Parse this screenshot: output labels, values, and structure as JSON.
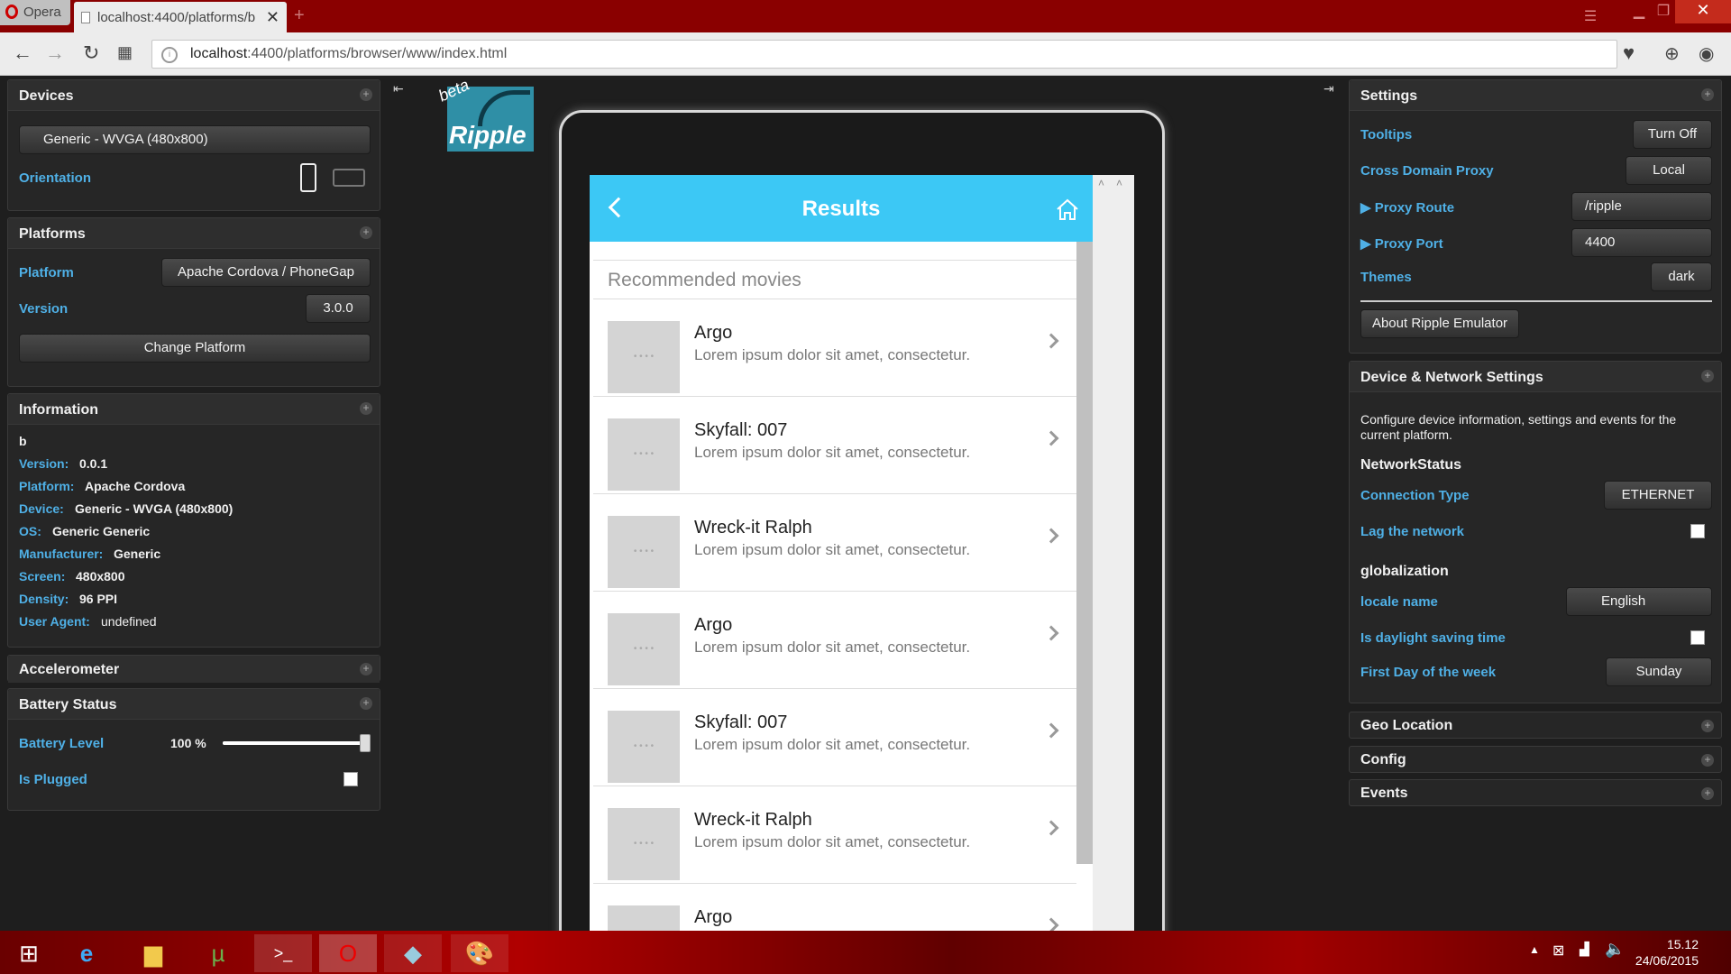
{
  "browser": {
    "app_name": "Opera",
    "tab_title": "localhost:4400/platforms/b",
    "url_host": "localhost",
    "url_path": ":4400/platforms/browser/www/index.html"
  },
  "devices": {
    "title": "Devices",
    "device_button": "Generic - WVGA (480x800)",
    "orientation_label": "Orientation"
  },
  "platforms": {
    "title": "Platforms",
    "platform_label": "Platform",
    "platform_value": "Apache Cordova / PhoneGap",
    "version_label": "Version",
    "version_value": "3.0.0",
    "change_button": "Change Platform"
  },
  "information": {
    "title": "Information",
    "name": "b",
    "rows": [
      {
        "label": "Version:",
        "value": "0.0.1"
      },
      {
        "label": "Platform:",
        "value": "Apache Cordova"
      },
      {
        "label": "Device:",
        "value": "Generic - WVGA (480x800)"
      },
      {
        "label": "OS:",
        "value": "Generic Generic"
      },
      {
        "label": "Manufacturer:",
        "value": "Generic"
      },
      {
        "label": "Screen:",
        "value": "480x800"
      },
      {
        "label": "Density:",
        "value": "96 PPI"
      },
      {
        "label": "User Agent:",
        "value": "undefined"
      }
    ]
  },
  "accelerometer": {
    "title": "Accelerometer"
  },
  "battery": {
    "title": "Battery Status",
    "level_label": "Battery Level",
    "level_value": "100 %",
    "level_fraction": 1.0,
    "plugged_label": "Is Plugged"
  },
  "logo": {
    "beta": "beta",
    "name": "Ripple"
  },
  "app": {
    "title": "Results",
    "list_header": "Recommended movies",
    "movies": [
      {
        "title": "Argo",
        "desc": "Lorem ipsum dolor sit amet, consectetur."
      },
      {
        "title": "Skyfall: 007",
        "desc": "Lorem ipsum dolor sit amet, consectetur."
      },
      {
        "title": "Wreck-it Ralph",
        "desc": "Lorem ipsum dolor sit amet, consectetur."
      },
      {
        "title": "Argo",
        "desc": "Lorem ipsum dolor sit amet, consectetur."
      },
      {
        "title": "Skyfall: 007",
        "desc": "Lorem ipsum dolor sit amet, consectetur."
      },
      {
        "title": "Wreck-it Ralph",
        "desc": "Lorem ipsum dolor sit amet, consectetur."
      },
      {
        "title": "Argo",
        "desc": ""
      }
    ]
  },
  "settings": {
    "title": "Settings",
    "tooltips_label": "Tooltips",
    "tooltips_button": "Turn Off",
    "proxy_label": "Cross Domain Proxy",
    "proxy_value": "Local",
    "route_label": "▶ Proxy Route",
    "route_value": "/ripple",
    "port_label": "▶ Proxy Port",
    "port_value": "4400",
    "themes_label": "Themes",
    "themes_value": "dark",
    "about_button": "About Ripple Emulator"
  },
  "network": {
    "title": "Device & Network Settings",
    "description": "Configure device information, settings and events for the current platform.",
    "status_heading": "NetworkStatus",
    "connection_label": "Connection Type",
    "connection_value": "ETHERNET",
    "lag_label": "Lag the network",
    "glob_heading": "globalization",
    "locale_label": "locale name",
    "locale_value": "English",
    "dst_label": "Is daylight saving time",
    "firstday_label": "First Day of the week",
    "firstday_value": "Sunday"
  },
  "collapsed": {
    "geo": "Geo Location",
    "config": "Config",
    "events": "Events"
  },
  "taskbar": {
    "time": "15.12",
    "date": "24/06/2015"
  },
  "colors": {
    "accent": "#4fb0e6",
    "app_header": "#3cc8f5",
    "titlebar": "#8a0000"
  }
}
